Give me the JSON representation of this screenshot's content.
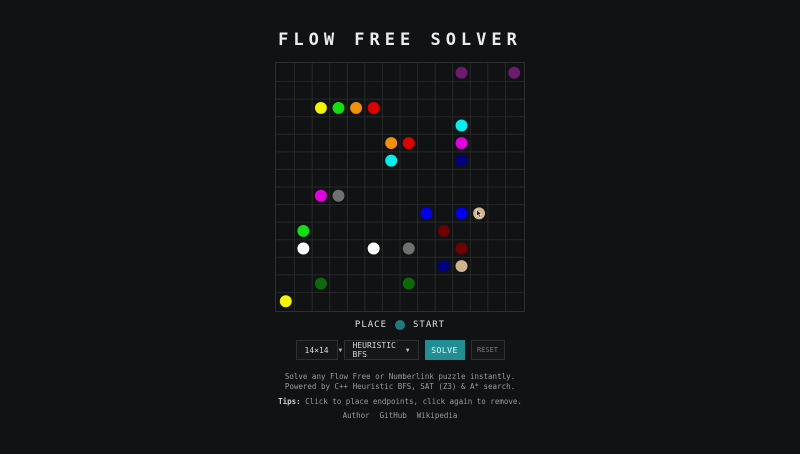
{
  "title": "FLOW FREE SOLVER",
  "board": {
    "size": 14,
    "colors": {
      "purple": "#6e1a6e",
      "yellow": "#f5f500",
      "green": "#10e010",
      "orange": "#f39200",
      "red": "#e00000",
      "cyan": "#00f0f0",
      "magenta": "#e000e0",
      "navy": "#000080",
      "gray": "#707070",
      "blue": "#0000ee",
      "tan": "#d2b48c",
      "maroon": "#700000",
      "white": "#ffffff",
      "darkgreen": "#0b6b0b"
    },
    "endpoints": [
      {
        "row": 0,
        "col": 10,
        "color": "purple"
      },
      {
        "row": 0,
        "col": 13,
        "color": "purple"
      },
      {
        "row": 2,
        "col": 2,
        "color": "yellow"
      },
      {
        "row": 2,
        "col": 3,
        "color": "green"
      },
      {
        "row": 2,
        "col": 4,
        "color": "orange"
      },
      {
        "row": 2,
        "col": 5,
        "color": "red"
      },
      {
        "row": 3,
        "col": 10,
        "color": "cyan"
      },
      {
        "row": 4,
        "col": 6,
        "color": "orange"
      },
      {
        "row": 4,
        "col": 7,
        "color": "red"
      },
      {
        "row": 4,
        "col": 10,
        "color": "magenta"
      },
      {
        "row": 5,
        "col": 6,
        "color": "cyan"
      },
      {
        "row": 5,
        "col": 10,
        "color": "navy"
      },
      {
        "row": 7,
        "col": 2,
        "color": "magenta"
      },
      {
        "row": 7,
        "col": 3,
        "color": "gray"
      },
      {
        "row": 8,
        "col": 8,
        "color": "blue"
      },
      {
        "row": 8,
        "col": 10,
        "color": "blue"
      },
      {
        "row": 8,
        "col": 11,
        "color": "tan"
      },
      {
        "row": 9,
        "col": 1,
        "color": "green"
      },
      {
        "row": 9,
        "col": 9,
        "color": "maroon"
      },
      {
        "row": 10,
        "col": 1,
        "color": "white"
      },
      {
        "row": 10,
        "col": 5,
        "color": "white"
      },
      {
        "row": 10,
        "col": 7,
        "color": "gray"
      },
      {
        "row": 10,
        "col": 10,
        "color": "maroon"
      },
      {
        "row": 11,
        "col": 9,
        "color": "navy"
      },
      {
        "row": 11,
        "col": 10,
        "color": "tan"
      },
      {
        "row": 12,
        "col": 2,
        "color": "darkgreen"
      },
      {
        "row": 12,
        "col": 7,
        "color": "darkgreen"
      },
      {
        "row": 13,
        "col": 0,
        "color": "yellow"
      }
    ],
    "cursor": {
      "row": 8,
      "col": 11
    }
  },
  "mode": {
    "left": "PLACE",
    "right": "START",
    "dot_color": "#1d7b7e"
  },
  "controls": {
    "size_select": "14×14",
    "algo_select": "HEURISTIC BFS",
    "solve_label": "SOLVE",
    "reset_label": "RESET"
  },
  "description": {
    "line1": "Solve any Flow Free or Numberlink puzzle instantly.",
    "line2": "Powered by C++ Heuristic BFS, SAT (Z3) & A* search."
  },
  "tips": {
    "label": "Tips:",
    "text": " Click to place endpoints, click again to remove."
  },
  "footer": {
    "author": "Author",
    "github": "GitHub",
    "wikipedia": "Wikipedia"
  }
}
